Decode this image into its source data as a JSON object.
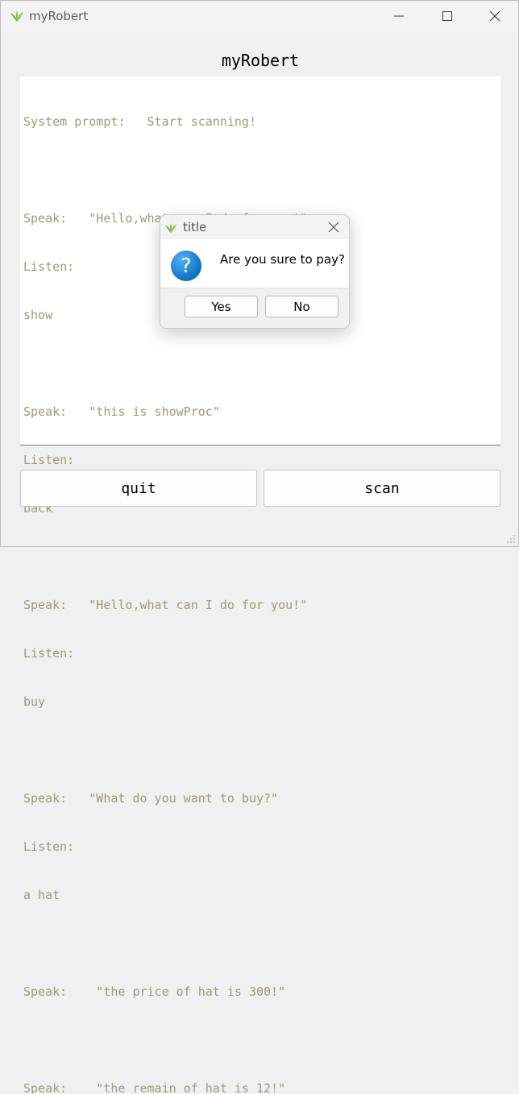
{
  "window": {
    "title": "myRobert",
    "icon": "leaf-icon"
  },
  "heading": "myRobert",
  "console": {
    "lines": [
      "System prompt:   Start scanning!",
      "",
      "Speak:   \"Hello,what can I do for you!\"",
      "Listen:",
      "show",
      "",
      "Speak:   \"this is showProc\"",
      "Listen:",
      "back",
      "",
      "Speak:   \"Hello,what can I do for you!\"",
      "Listen:",
      "buy",
      "",
      "Speak:   \"What do you want to buy?\"",
      "Listen:",
      "a hat",
      "",
      "Speak:    \"the price of hat is 300!\"",
      "",
      "Speak:    \"the remain of hat is 12!\""
    ],
    "text_color": "#9e9a72"
  },
  "buttons": {
    "quit": "quit",
    "scan": "scan"
  },
  "dialog": {
    "title": "title",
    "message": "Are you sure to pay?",
    "icon": "question-icon",
    "yes": "Yes",
    "no": "No"
  }
}
